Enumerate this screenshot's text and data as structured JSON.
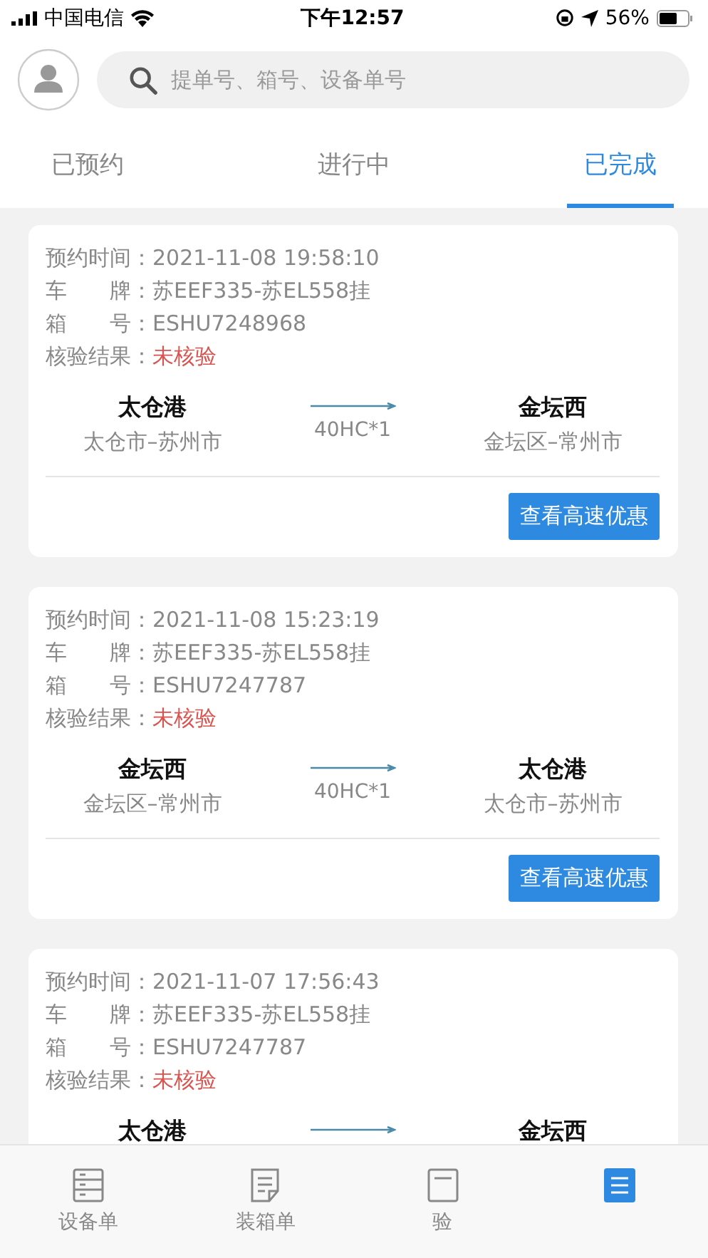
{
  "status_bar": {
    "carrier": "中国电信",
    "time": "下午12:57",
    "battery": "56%"
  },
  "search": {
    "placeholder": "提单号、箱号、设备单号"
  },
  "tabs": [
    {
      "label": "已预约",
      "selected": false
    },
    {
      "label": "进行中",
      "selected": false
    },
    {
      "label": "已完成",
      "selected": true
    }
  ],
  "orders": [
    {
      "fields": [
        {
          "label": "预约时间：",
          "value": "2021-11-08 19:58:10"
        },
        {
          "label": "车　　牌：",
          "value": "苏EEF335-苏EL558挂"
        },
        {
          "label": "箱　　号：",
          "value": "ESHU7248968"
        },
        {
          "label": "核验结果：",
          "value": "未核验",
          "kind": "alert"
        }
      ],
      "origin": {
        "name": "太仓港",
        "city": "太仓市–苏州市"
      },
      "cargo": "40HC*1",
      "destination": {
        "name": "金坛西",
        "city": "金坛区–常州市"
      },
      "button": "查看高速优惠"
    },
    {
      "fields": [
        {
          "label": "预约时间：",
          "value": "2021-11-08 15:23:19"
        },
        {
          "label": "车　　牌：",
          "value": "苏EEF335-苏EL558挂"
        },
        {
          "label": "箱　　号：",
          "value": "ESHU7247787"
        },
        {
          "label": "核验结果：",
          "value": "未核验",
          "kind": "alert"
        }
      ],
      "origin": {
        "name": "金坛西",
        "city": "金坛区–常州市"
      },
      "cargo": "40HC*1",
      "destination": {
        "name": "太仓港",
        "city": "太仓市–苏州市"
      },
      "button": "查看高速优惠"
    },
    {
      "fields": [
        {
          "label": "预约时间：",
          "value": "2021-11-07 17:56:43"
        },
        {
          "label": "车　　牌：",
          "value": "苏EEF335-苏EL558挂"
        },
        {
          "label": "箱　　号：",
          "value": "ESHU7247787"
        },
        {
          "label": "核验结果：",
          "value": "未核验",
          "kind": "alert"
        }
      ],
      "origin": {
        "name": "太仓港"
      },
      "destination": {
        "name": "金坛西"
      }
    }
  ],
  "bottom_tabs": [
    {
      "label": "设备单",
      "kind": "cabinet",
      "selected": false
    },
    {
      "label": "装箱单",
      "kind": "document",
      "selected": false
    },
    {
      "label": "验",
      "kind": "form",
      "selected": false
    },
    {
      "kind": "list",
      "selected": true
    }
  ]
}
